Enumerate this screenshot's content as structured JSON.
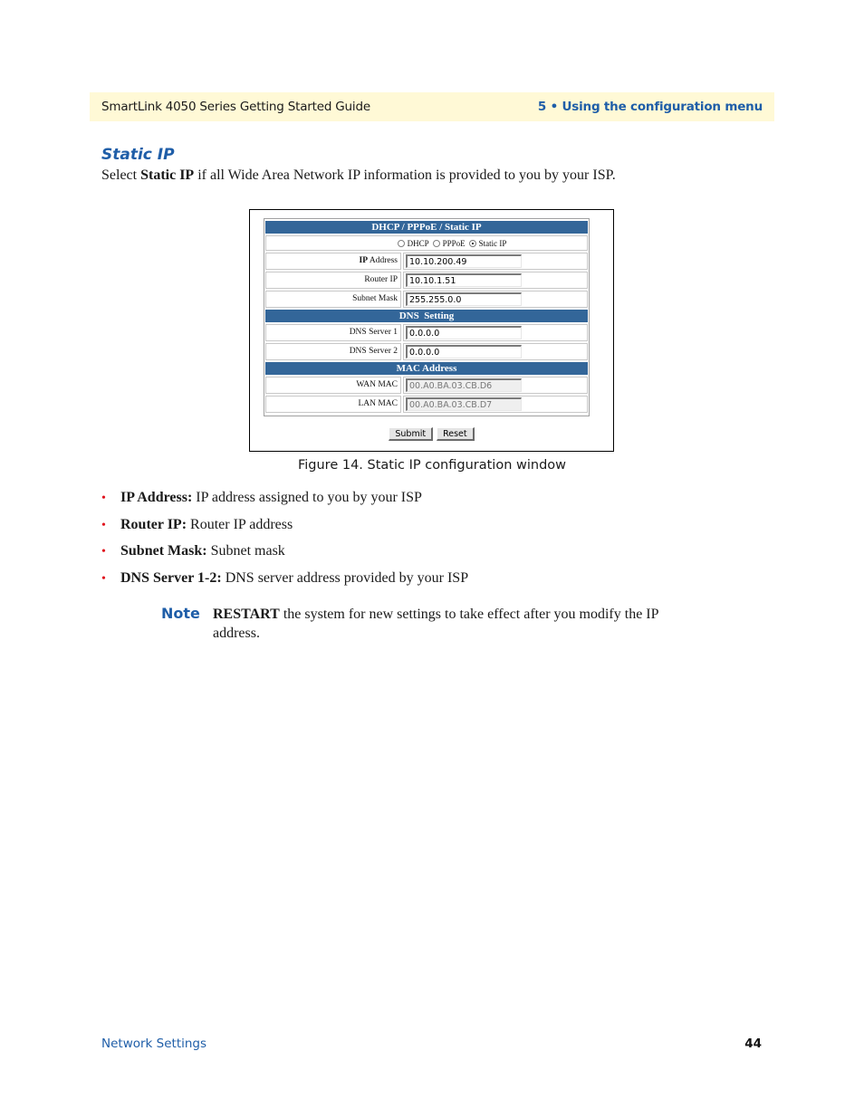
{
  "header": {
    "guide_title": "SmartLink 4050 Series Getting Started Guide",
    "chapter": "5 • Using the configuration menu"
  },
  "section": {
    "title": "Static IP",
    "intro_prefix": "Select ",
    "intro_bold": "Static IP",
    "intro_suffix": " if all Wide Area Network IP information is provided to you by your ISP."
  },
  "figure": {
    "caption": "Figure 14. Static IP configuration window",
    "headers": {
      "connection": "DHCP / PPPoE / Static IP",
      "dns": "DNS  Setting",
      "mac": "MAC Address"
    },
    "radio_options": [
      {
        "label": "DHCP",
        "checked": false
      },
      {
        "label": "PPPoE",
        "checked": false
      },
      {
        "label": "Static IP",
        "checked": true
      }
    ],
    "fields": {
      "ip_address": {
        "label_bold": "IP",
        "label_rest": " Address",
        "value": "10.10.200.49"
      },
      "router_ip": {
        "label": "Router IP",
        "value": "10.10.1.51"
      },
      "subnet_mask": {
        "label": "Subnet Mask",
        "value": "255.255.0.0"
      },
      "dns1": {
        "label": "DNS Server 1",
        "value": "0.0.0.0"
      },
      "dns2": {
        "label": "DNS Server 2",
        "value": "0.0.0.0"
      },
      "wan_mac": {
        "label": "WAN MAC",
        "value": "00.A0.BA.03.CB.D6"
      },
      "lan_mac": {
        "label": "LAN MAC",
        "value": "00.A0.BA.03.CB.D7"
      }
    },
    "buttons": {
      "submit": "Submit",
      "reset": "Reset"
    }
  },
  "bullets": [
    {
      "bold": "IP Address:",
      "text": " IP address assigned to you by your ISP"
    },
    {
      "bold": "Router IP:",
      "text": " Router IP address"
    },
    {
      "bold": "Subnet Mask:",
      "text": " Subnet mask"
    },
    {
      "bold": "DNS Server 1-2:",
      "text": " DNS server address provided by your ISP"
    }
  ],
  "note": {
    "label": "Note",
    "bold": "RESTART",
    "text": " the system for new settings to take effect after you modify the IP address."
  },
  "footer": {
    "section": "Network Settings",
    "page_number": "44"
  },
  "colors": {
    "brand_blue": "#1f5ea8",
    "table_header": "#336699",
    "header_bar_bg": "#fff9d6",
    "bullet_red": "#e0141e"
  }
}
